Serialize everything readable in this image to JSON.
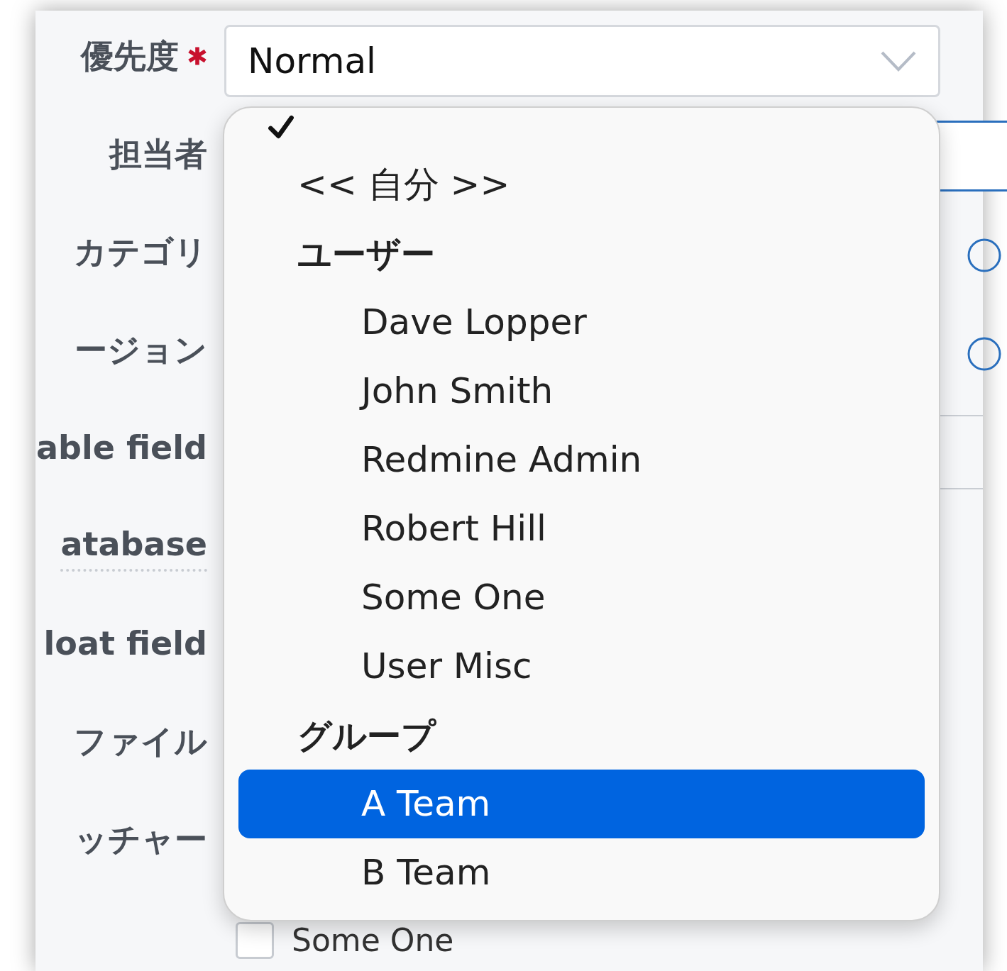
{
  "labels": [
    {
      "text": "優先度",
      "required": true
    },
    {
      "text": "担当者",
      "required": false
    },
    {
      "text": "カテゴリ",
      "required": false
    },
    {
      "text": "ージョン",
      "required": false
    },
    {
      "text": "able field",
      "required": false
    },
    {
      "text": "atabase",
      "required": false,
      "dotted": true
    },
    {
      "text": "loat field",
      "required": false
    },
    {
      "text": "ファイル",
      "required": false
    },
    {
      "text": "ッチャー",
      "required": false
    }
  ],
  "priority_select": {
    "value": "Normal"
  },
  "dropdown": {
    "items": [
      {
        "kind": "option",
        "checked": true,
        "selected": false
      },
      {
        "kind": "option",
        "label": "<< 自分 >>",
        "checked": false,
        "selected": false
      },
      {
        "kind": "group",
        "label": "ユーザー",
        "children": [
          {
            "label": "Dave Lopper",
            "selected": false
          },
          {
            "label": "John Smith",
            "selected": false
          },
          {
            "label": "Redmine Admin",
            "selected": false
          },
          {
            "label": "Robert Hill",
            "selected": false
          },
          {
            "label": "Some One",
            "selected": false
          },
          {
            "label": "User Misc",
            "selected": false
          }
        ]
      },
      {
        "kind": "group",
        "label": "グループ",
        "children": [
          {
            "label": "A Team",
            "selected": true
          },
          {
            "label": "B Team",
            "selected": false
          }
        ]
      }
    ]
  },
  "watcher": {
    "label": "Some One",
    "checked": false
  }
}
